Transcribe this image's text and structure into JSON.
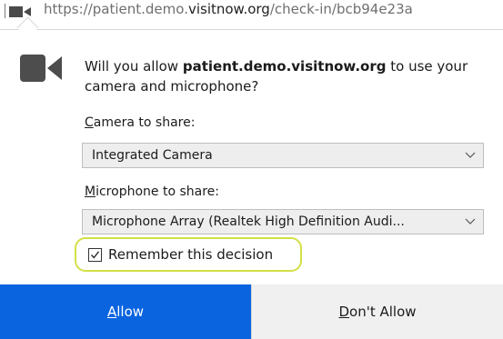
{
  "urlbar": {
    "url_prefix": "https://patient.demo.",
    "url_domain": "visitnow.org",
    "url_suffix": "/check-in/bcb94e23a"
  },
  "prompt": {
    "question_prefix": "Will you allow ",
    "question_host": "patient.demo.visitnow.org",
    "question_suffix": " to use your camera and microphone?"
  },
  "camera": {
    "label_accel": "C",
    "label_rest": "amera to share:",
    "selected": "Integrated Camera"
  },
  "microphone": {
    "label_accel": "M",
    "label_rest": "icrophone to share:",
    "selected": "Microphone Array (Realtek High Definition Audi..."
  },
  "remember": {
    "label": "Remember this decision",
    "checked": true,
    "highlight_color": "#d3e046"
  },
  "buttons": {
    "allow_accel": "A",
    "allow_rest": "llow",
    "deny_accel": "D",
    "deny_rest": "on't Allow"
  },
  "colors": {
    "allow_bg": "#0a64e0",
    "deny_bg": "#f0f0f0",
    "select_bg": "#eeeeee"
  },
  "icons": {
    "url_camera": "camera-icon",
    "panel_camera": "camera-icon",
    "select_chevron": "chevron-down-icon",
    "checkbox": "checkmark-icon"
  }
}
